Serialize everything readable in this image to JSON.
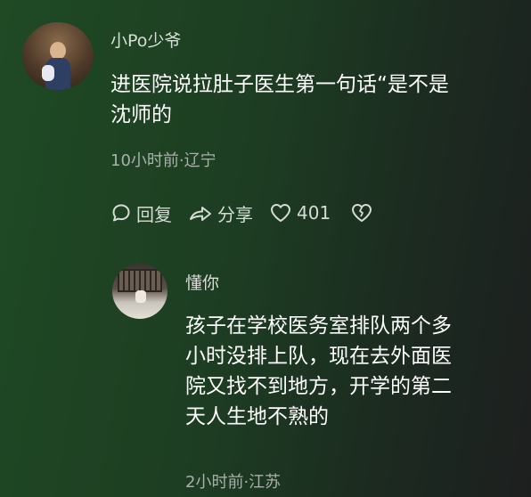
{
  "comment": {
    "username": "小Po少爷",
    "text_line1": "进医院说拉肚子医生第一句话“是不是",
    "text_line2": "沈师的",
    "meta": "10小时前·辽宁",
    "actions": {
      "reply_label": "回复",
      "share_label": "分享",
      "like_count": "401"
    }
  },
  "reply": {
    "username": "懂你",
    "text_line1": "孩子在学校医务室排队两个多",
    "text_line2": "小时没排上队，现在去外面医",
    "text_line3": "院又找不到地方，开学的第二",
    "text_line4": "天人生地不熟的",
    "meta": "2小时前·江苏"
  },
  "icons": {
    "reply": "comment-bubble-icon",
    "share": "share-arrow-icon",
    "like": "heart-icon",
    "dislike": "broken-heart-icon"
  }
}
